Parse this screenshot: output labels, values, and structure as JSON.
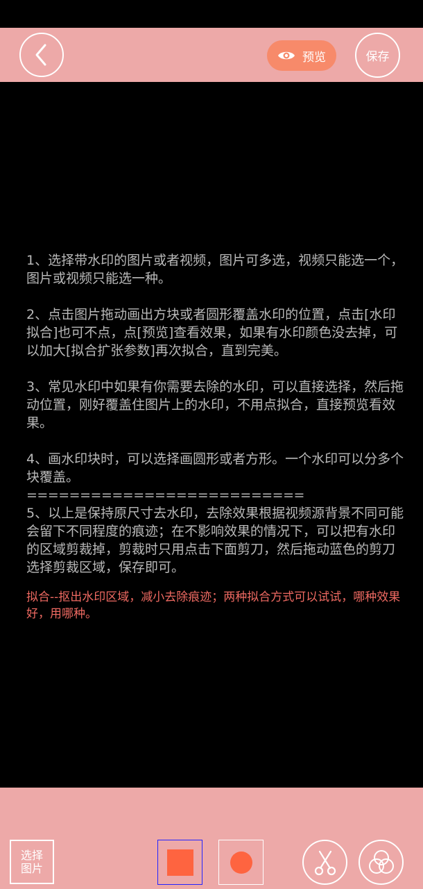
{
  "header": {
    "preview_label": "预览",
    "save_label": "保存"
  },
  "instructions": {
    "p1": "1、选择带水印的图片或者视频，图片可多选，视频只能选一个，图片或视频只能选一种。",
    "p2": "2、点击图片拖动画出方块或者圆形覆盖水印的位置，点击[水印拟合]也可不点，点[预览]查看效果，如果有水印颜色没去掉，可以加大[拟合扩张参数]再次拟合，直到完美。",
    "p3": "3、常见水印中如果有你需要去除的水印，可以直接选择，然后拖动位置，刚好覆盖住图片上的水印，不用点拟合，直接预览看效果。",
    "p4": "4、画水印块时，可以选择画圆形或者方形。一个水印可以分多个块覆盖。",
    "divider": "==================================",
    "p5": "5、以上是保持原尺寸去水印，去除效果根据视频源背景不同可能会留下不同程度的痕迹；在不影响效果的情况下，可以把有水印的区域剪裁掉，剪裁时只用点击下面剪刀，然后拖动蓝色的剪刀选择剪裁区域，保存即可。",
    "hint": "拟合--抠出水印区域，减小去除痕迹；两种拟合方式可以试试，哪种效果好，用哪种。"
  },
  "bottom": {
    "select_label": "选择图片"
  },
  "colors": {
    "bar_bg": "#eda9a8",
    "accent": "#fe6440",
    "preview_bg": "#f78a6a",
    "hint_text": "#ef6a62",
    "body_text": "#b9b9b9",
    "selected_border": "#2323ff"
  },
  "icons": {
    "back": "chevron-left-icon",
    "preview": "eye-icon",
    "scissors": "scissors-icon",
    "blend": "overlapping-circles-icon"
  }
}
